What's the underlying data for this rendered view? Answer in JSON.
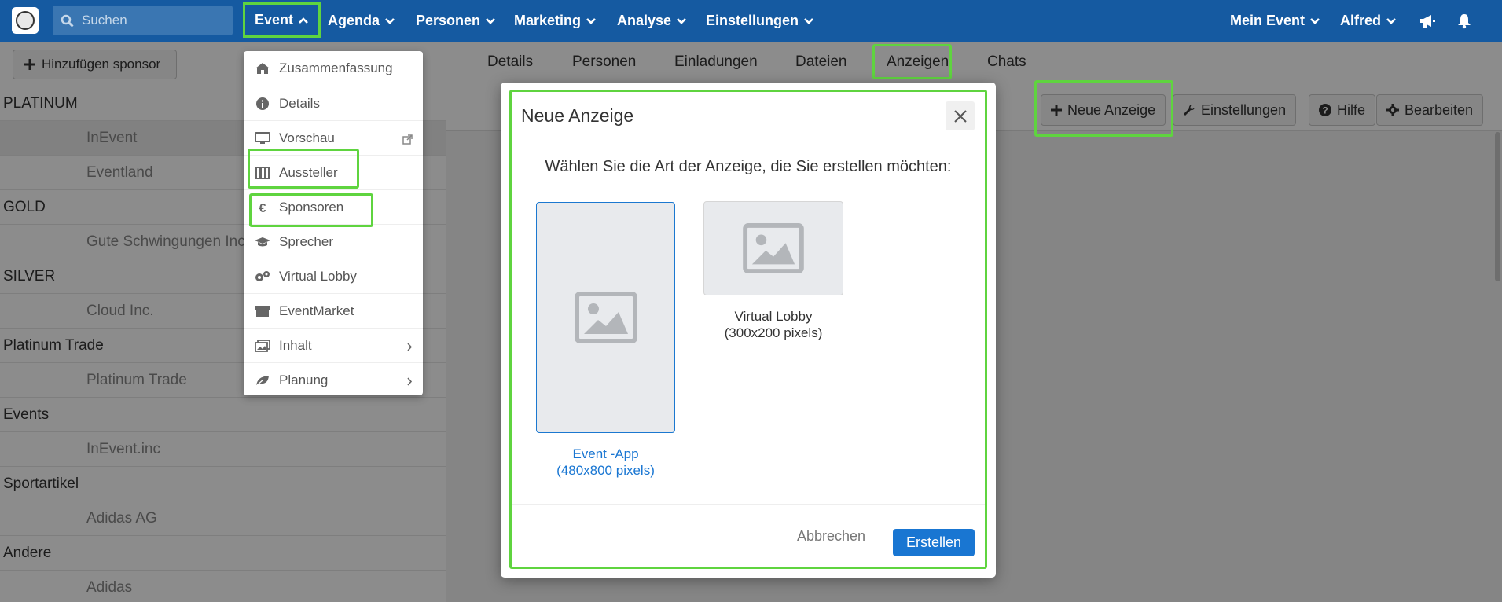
{
  "topnav": {
    "search_placeholder": "Suchen",
    "items": [
      {
        "label": "Event"
      },
      {
        "label": "Agenda"
      },
      {
        "label": "Personen"
      },
      {
        "label": "Marketing"
      },
      {
        "label": "Analyse"
      },
      {
        "label": "Einstellungen"
      }
    ],
    "right": {
      "event_label": "Mein Event",
      "user_label": "Alfred"
    },
    "icons": {
      "announce": "megaphone-icon",
      "notifications": "bell-icon"
    },
    "colors": {
      "bar": "#155aa1",
      "highlight": "#5fd43f"
    }
  },
  "event_menu": {
    "items": [
      {
        "label": "Zusammenfassung",
        "icon": "home-icon"
      },
      {
        "label": "Details",
        "icon": "info-circle-icon"
      },
      {
        "label": "Vorschau",
        "icon": "monitor-icon",
        "trail": "external-link-icon"
      },
      {
        "label": "Aussteller",
        "icon": "booth-icon"
      },
      {
        "label": "Sponsoren",
        "icon": "euro-icon"
      },
      {
        "label": "Sprecher",
        "icon": "graduation-cap-icon"
      },
      {
        "label": "Virtual Lobby",
        "icon": "cogs-icon"
      },
      {
        "label": "EventMarket",
        "icon": "store-icon"
      },
      {
        "label": "Inhalt",
        "icon": "images-icon",
        "trail": "chevron-right-icon"
      },
      {
        "label": "Planung",
        "icon": "leaf-icon",
        "trail": "chevron-right-icon"
      }
    ]
  },
  "sponsors": {
    "add_button": "Hinzufügen sponsor",
    "groups": [
      {
        "name": "PLATINUM",
        "items": [
          "InEvent",
          "Eventland"
        ]
      },
      {
        "name": "GOLD",
        "items": [
          "Gute Schwingungen Inc"
        ]
      },
      {
        "name": "SILVER",
        "items": [
          "Cloud Inc."
        ]
      },
      {
        "name": "Platinum Trade",
        "items": [
          "Platinum Trade"
        ]
      },
      {
        "name": "Events",
        "items": [
          "InEvent.inc"
        ]
      },
      {
        "name": "Sportartikel",
        "items": [
          "Adidas AG"
        ]
      },
      {
        "name": "Andere",
        "items": [
          "Adidas"
        ]
      }
    ]
  },
  "tabs": [
    "Details",
    "Personen",
    "Einladungen",
    "Dateien",
    "Anzeigen",
    "Chats"
  ],
  "toolbar": {
    "new_ad": "Neue Anzeige",
    "settings": "Einstellungen",
    "help": "Hilfe",
    "edit": "Bearbeiten"
  },
  "modal": {
    "title": "Neue Anzeige",
    "prompt": "Wählen Sie die Art der Anzeige, die Sie erstellen möchten:",
    "options": [
      {
        "label": "Event -App",
        "size": "(480x800 pixels)",
        "selected": true
      },
      {
        "label": "Virtual Lobby",
        "size": "(300x200 pixels)",
        "selected": false
      }
    ],
    "cancel": "Abbrechen",
    "create": "Erstellen",
    "accent": "#1976d2"
  }
}
